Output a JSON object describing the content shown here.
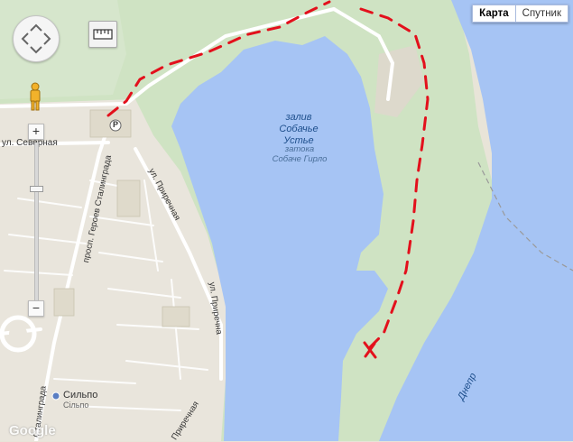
{
  "map_type": {
    "map_label": "Карта",
    "satellite_label": "Спутник"
  },
  "water": {
    "bay_name_1": "залив",
    "bay_name_2": "Собачье",
    "bay_name_3": "Устье",
    "bay_alt_1": "затока",
    "bay_alt_2": "Собаче Гирло",
    "river_name": "Днепр"
  },
  "streets": {
    "severnaya": "ул. Северная",
    "prospect": "просп. Героев Сталинграда",
    "pririchnaya_top": "ул. Приречная",
    "pririchnaya_right": "ул. Приречна",
    "pririchnaya_bottom": "Приречная",
    "stalingrada_bottom": "Сталинграда"
  },
  "places": {
    "store": "Сильпо",
    "store_alt": "Сільпо",
    "parking": "P"
  },
  "branding": {
    "logo": "Google"
  },
  "controls": {
    "zoom_in": "+",
    "zoom_out": "−"
  },
  "colors": {
    "water": "#a6c4f4",
    "land": "#e8e4d8",
    "park": "#cbe1c0",
    "route": "#e3101c"
  }
}
